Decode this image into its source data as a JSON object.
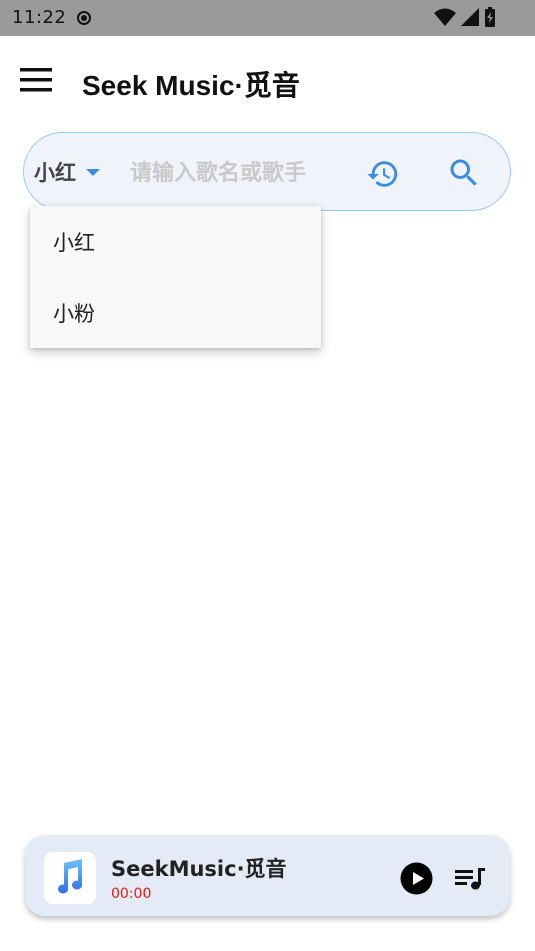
{
  "status_bar": {
    "time": "11:22"
  },
  "app_bar": {
    "title": "Seek Music·觅音",
    "menu_icon": "hamburger-menu-icon"
  },
  "search": {
    "source_selected": "小红",
    "placeholder": "请输入歌名或歌手",
    "value": "",
    "history_icon": "history-icon",
    "search_icon": "search-icon",
    "accent_color": "#3a8de0"
  },
  "source_dropdown": {
    "options": [
      "小红",
      "小粉"
    ]
  },
  "player": {
    "title": "SeekMusic·觅音",
    "time": "00:00",
    "time_color": "#e01818",
    "album_icon": "music-note-icon",
    "play_icon": "play-icon",
    "queue_icon": "playlist-icon"
  }
}
